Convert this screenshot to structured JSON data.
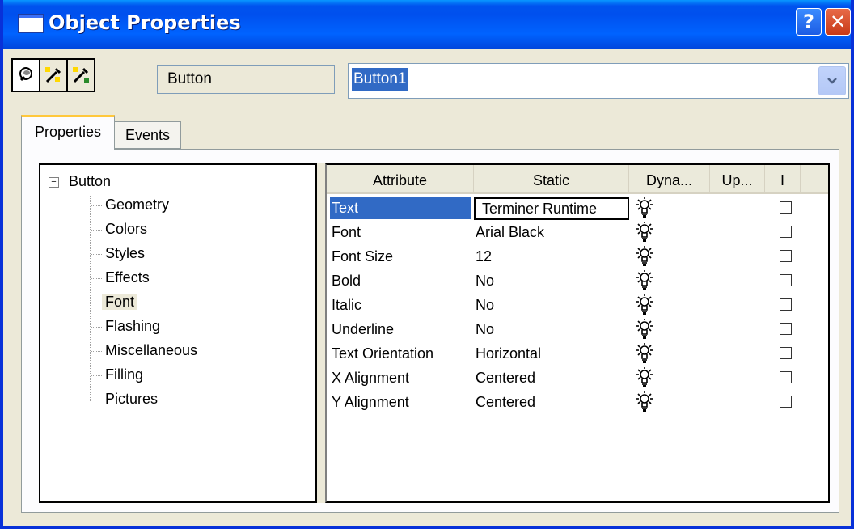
{
  "window": {
    "title": "Object Properties"
  },
  "toolbar": {
    "object_type": "Button",
    "object_name": "Button1"
  },
  "tabs": [
    {
      "label": "Properties",
      "active": true
    },
    {
      "label": "Events",
      "active": false
    }
  ],
  "tree": {
    "root": "Button",
    "items": [
      "Geometry",
      "Colors",
      "Styles",
      "Effects",
      "Font",
      "Flashing",
      "Miscellaneous",
      "Filling",
      "Pictures"
    ],
    "selected": "Font"
  },
  "grid": {
    "columns": [
      "Attribute",
      "Static",
      "Dyna...",
      "Up...",
      "I"
    ],
    "rows": [
      {
        "attribute": "Text",
        "static": "Terminer Runtime"
      },
      {
        "attribute": "Font",
        "static": "Arial Black"
      },
      {
        "attribute": "Font Size",
        "static": "12"
      },
      {
        "attribute": "Bold",
        "static": "No"
      },
      {
        "attribute": "Italic",
        "static": "No"
      },
      {
        "attribute": "Underline",
        "static": "No"
      },
      {
        "attribute": "Text Orientation",
        "static": "Horizontal"
      },
      {
        "attribute": "X Alignment",
        "static": "Centered"
      },
      {
        "attribute": "Y Alignment",
        "static": "Centered"
      }
    ],
    "selected_row": "Text"
  },
  "colors": {
    "titlebar": "#0054e3",
    "selection": "#316ac5",
    "tab_highlight": "#ffc83c",
    "face": "#ece9d8"
  },
  "icons": [
    "window-icon",
    "help-icon",
    "close-icon",
    "pin-icon",
    "pipette-icon",
    "pipette-pin-icon",
    "dropdown-arrow-icon",
    "tree-collapse-icon",
    "lightbulb-icon"
  ]
}
